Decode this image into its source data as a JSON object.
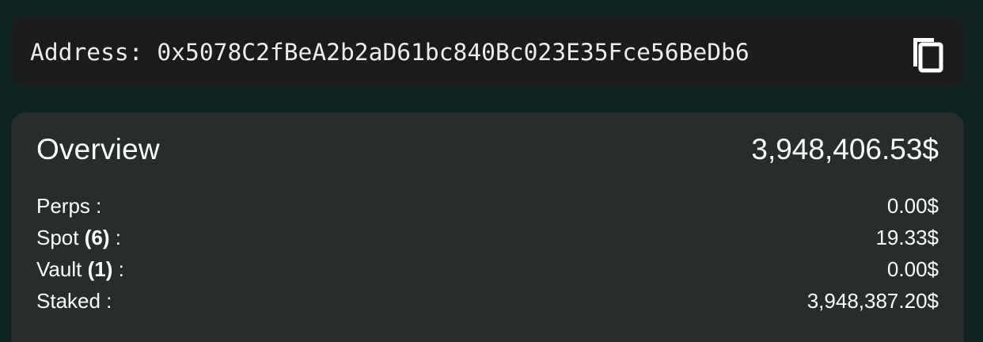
{
  "address": {
    "label": "Address:",
    "value": "0x5078C2fBeA2b2aD61bc840Bc023E35Fce56BeDb6",
    "copy_icon": "copy-icon"
  },
  "overview": {
    "title": "Overview",
    "total": "3,948,406.53$",
    "rows": [
      {
        "label": "Perps",
        "count": "",
        "suffix": " :",
        "value": "0.00$"
      },
      {
        "label": "Spot",
        "count": "(6)",
        "suffix": " :",
        "value": "19.33$"
      },
      {
        "label": "Vault",
        "count": "(1)",
        "suffix": " :",
        "value": "0.00$"
      },
      {
        "label": "Staked",
        "count": "",
        "suffix": " :",
        "value": "3,948,387.20$"
      }
    ]
  },
  "colors": {
    "background": "#0f2420",
    "address_bar": "#1a1c1c",
    "card": "#272c2d",
    "text": "#ffffff"
  }
}
